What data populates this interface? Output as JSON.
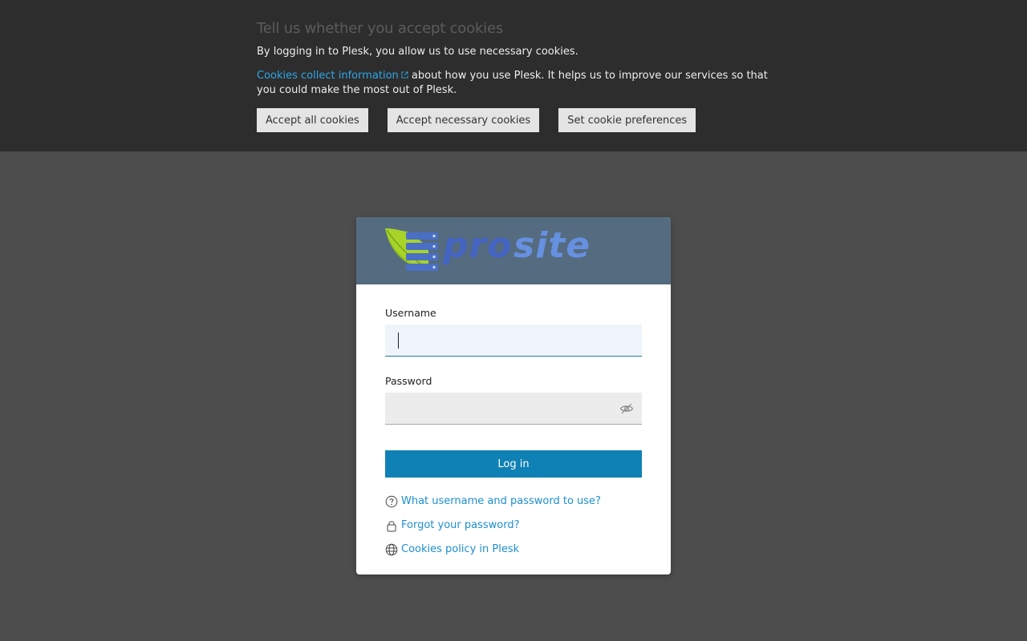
{
  "cookie_banner": {
    "title": "Tell us whether you accept cookies",
    "text1": "By logging in to Plesk, you allow us to use necessary cookies.",
    "link_text": "Cookies collect information",
    "text2": "about how you use Plesk. It helps us to improve our services so that you could make the most out of Plesk.",
    "buttons": {
      "accept_all": "Accept all cookies",
      "accept_necessary": "Accept necessary cookies",
      "preferences": "Set cookie preferences"
    }
  },
  "login": {
    "username_label": "Username",
    "username_value": "",
    "password_label": "Password",
    "password_value": "",
    "submit_label": "Log in"
  },
  "help_links": [
    {
      "label": "What username and password to use?",
      "icon": "question-circle-icon"
    },
    {
      "label": "Forgot your password?",
      "icon": "lock-icon"
    },
    {
      "label": "Cookies policy in Plesk",
      "icon": "globe-icon"
    }
  ],
  "colors": {
    "banner_bg": "#2d2d2d",
    "page_bg": "#4d4d4d",
    "header_bg": "#546b80",
    "primary": "#1081b4",
    "link": "#1d8fd0"
  }
}
